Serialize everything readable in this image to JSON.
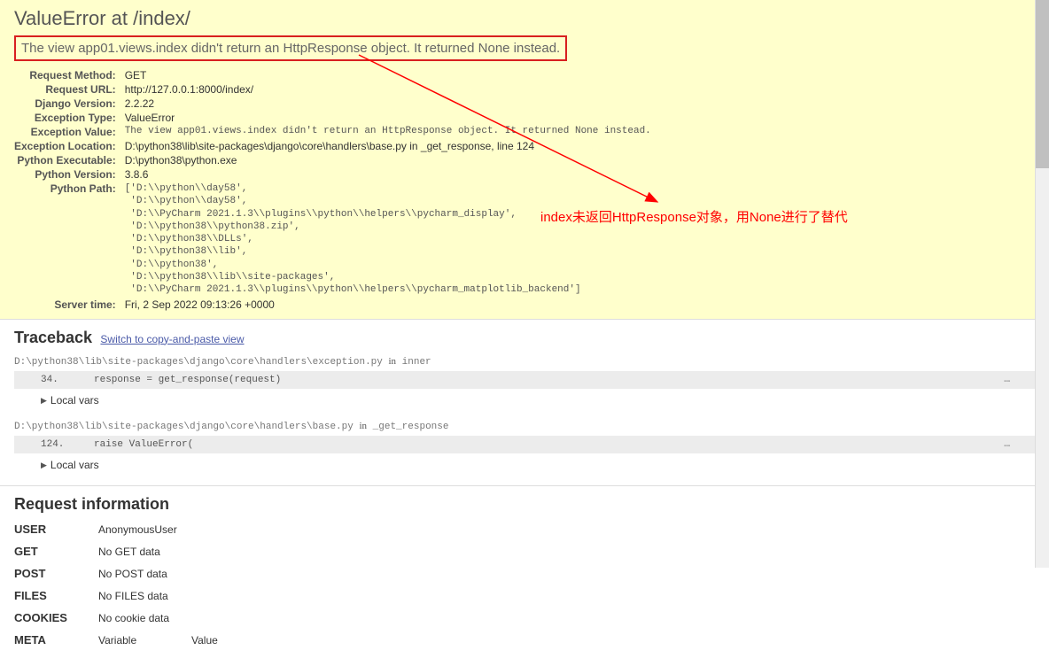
{
  "header": {
    "title": "ValueError at /index/",
    "error_message": "The view app01.views.index didn't return an HttpResponse object. It returned None instead."
  },
  "meta": {
    "request_method": {
      "label": "Request Method:",
      "value": "GET"
    },
    "request_url": {
      "label": "Request URL:",
      "value": "http://127.0.0.1:8000/index/"
    },
    "django_version": {
      "label": "Django Version:",
      "value": "2.2.22"
    },
    "exception_type": {
      "label": "Exception Type:",
      "value": "ValueError"
    },
    "exception_value": {
      "label": "Exception Value:",
      "value": "The view app01.views.index didn't return an HttpResponse object. It returned None instead."
    },
    "exception_location": {
      "label": "Exception Location:",
      "value": "D:\\python38\\lib\\site-packages\\django\\core\\handlers\\base.py in _get_response, line 124"
    },
    "python_executable": {
      "label": "Python Executable:",
      "value": "D:\\python38\\python.exe"
    },
    "python_version": {
      "label": "Python Version:",
      "value": "3.8.6"
    },
    "python_path": {
      "label": "Python Path:",
      "value": "['D:\\\\python\\\\day58',\n 'D:\\\\python\\\\day58',\n 'D:\\\\PyCharm 2021.1.3\\\\plugins\\\\python\\\\helpers\\\\pycharm_display',\n 'D:\\\\python38\\\\python38.zip',\n 'D:\\\\python38\\\\DLLs',\n 'D:\\\\python38\\\\lib',\n 'D:\\\\python38',\n 'D:\\\\python38\\\\lib\\\\site-packages',\n 'D:\\\\PyCharm 2021.1.3\\\\plugins\\\\python\\\\helpers\\\\pycharm_matplotlib_backend']"
    },
    "server_time": {
      "label": "Server time:",
      "value": "Fri, 2 Sep 2022 09:13:26 +0000"
    }
  },
  "annotation": "index未返回HttpResponse对象，用None进行了替代",
  "traceback": {
    "title": "Traceback",
    "switch_link": "Switch to copy-and-paste view",
    "frames": [
      {
        "loc": "D:\\python38\\lib\\site-packages\\django\\core\\handlers\\exception.py",
        "in": "inner",
        "lineno": "34.",
        "code": "response = get_response(request)",
        "local_vars": "Local vars"
      },
      {
        "loc": "D:\\python38\\lib\\site-packages\\django\\core\\handlers\\base.py",
        "in": "_get_response",
        "lineno": "124.",
        "code": "raise ValueError(",
        "local_vars": "Local vars"
      }
    ]
  },
  "request_info": {
    "title": "Request information",
    "rows": {
      "user": {
        "label": "USER",
        "value": "AnonymousUser"
      },
      "get": {
        "label": "GET",
        "value": "No GET data"
      },
      "post": {
        "label": "POST",
        "value": "No POST data"
      },
      "files": {
        "label": "FILES",
        "value": "No FILES data"
      },
      "cookies": {
        "label": "COOKIES",
        "value": "No cookie data"
      },
      "meta": {
        "label": "META",
        "col1": "Variable",
        "col2": "Value"
      }
    }
  }
}
